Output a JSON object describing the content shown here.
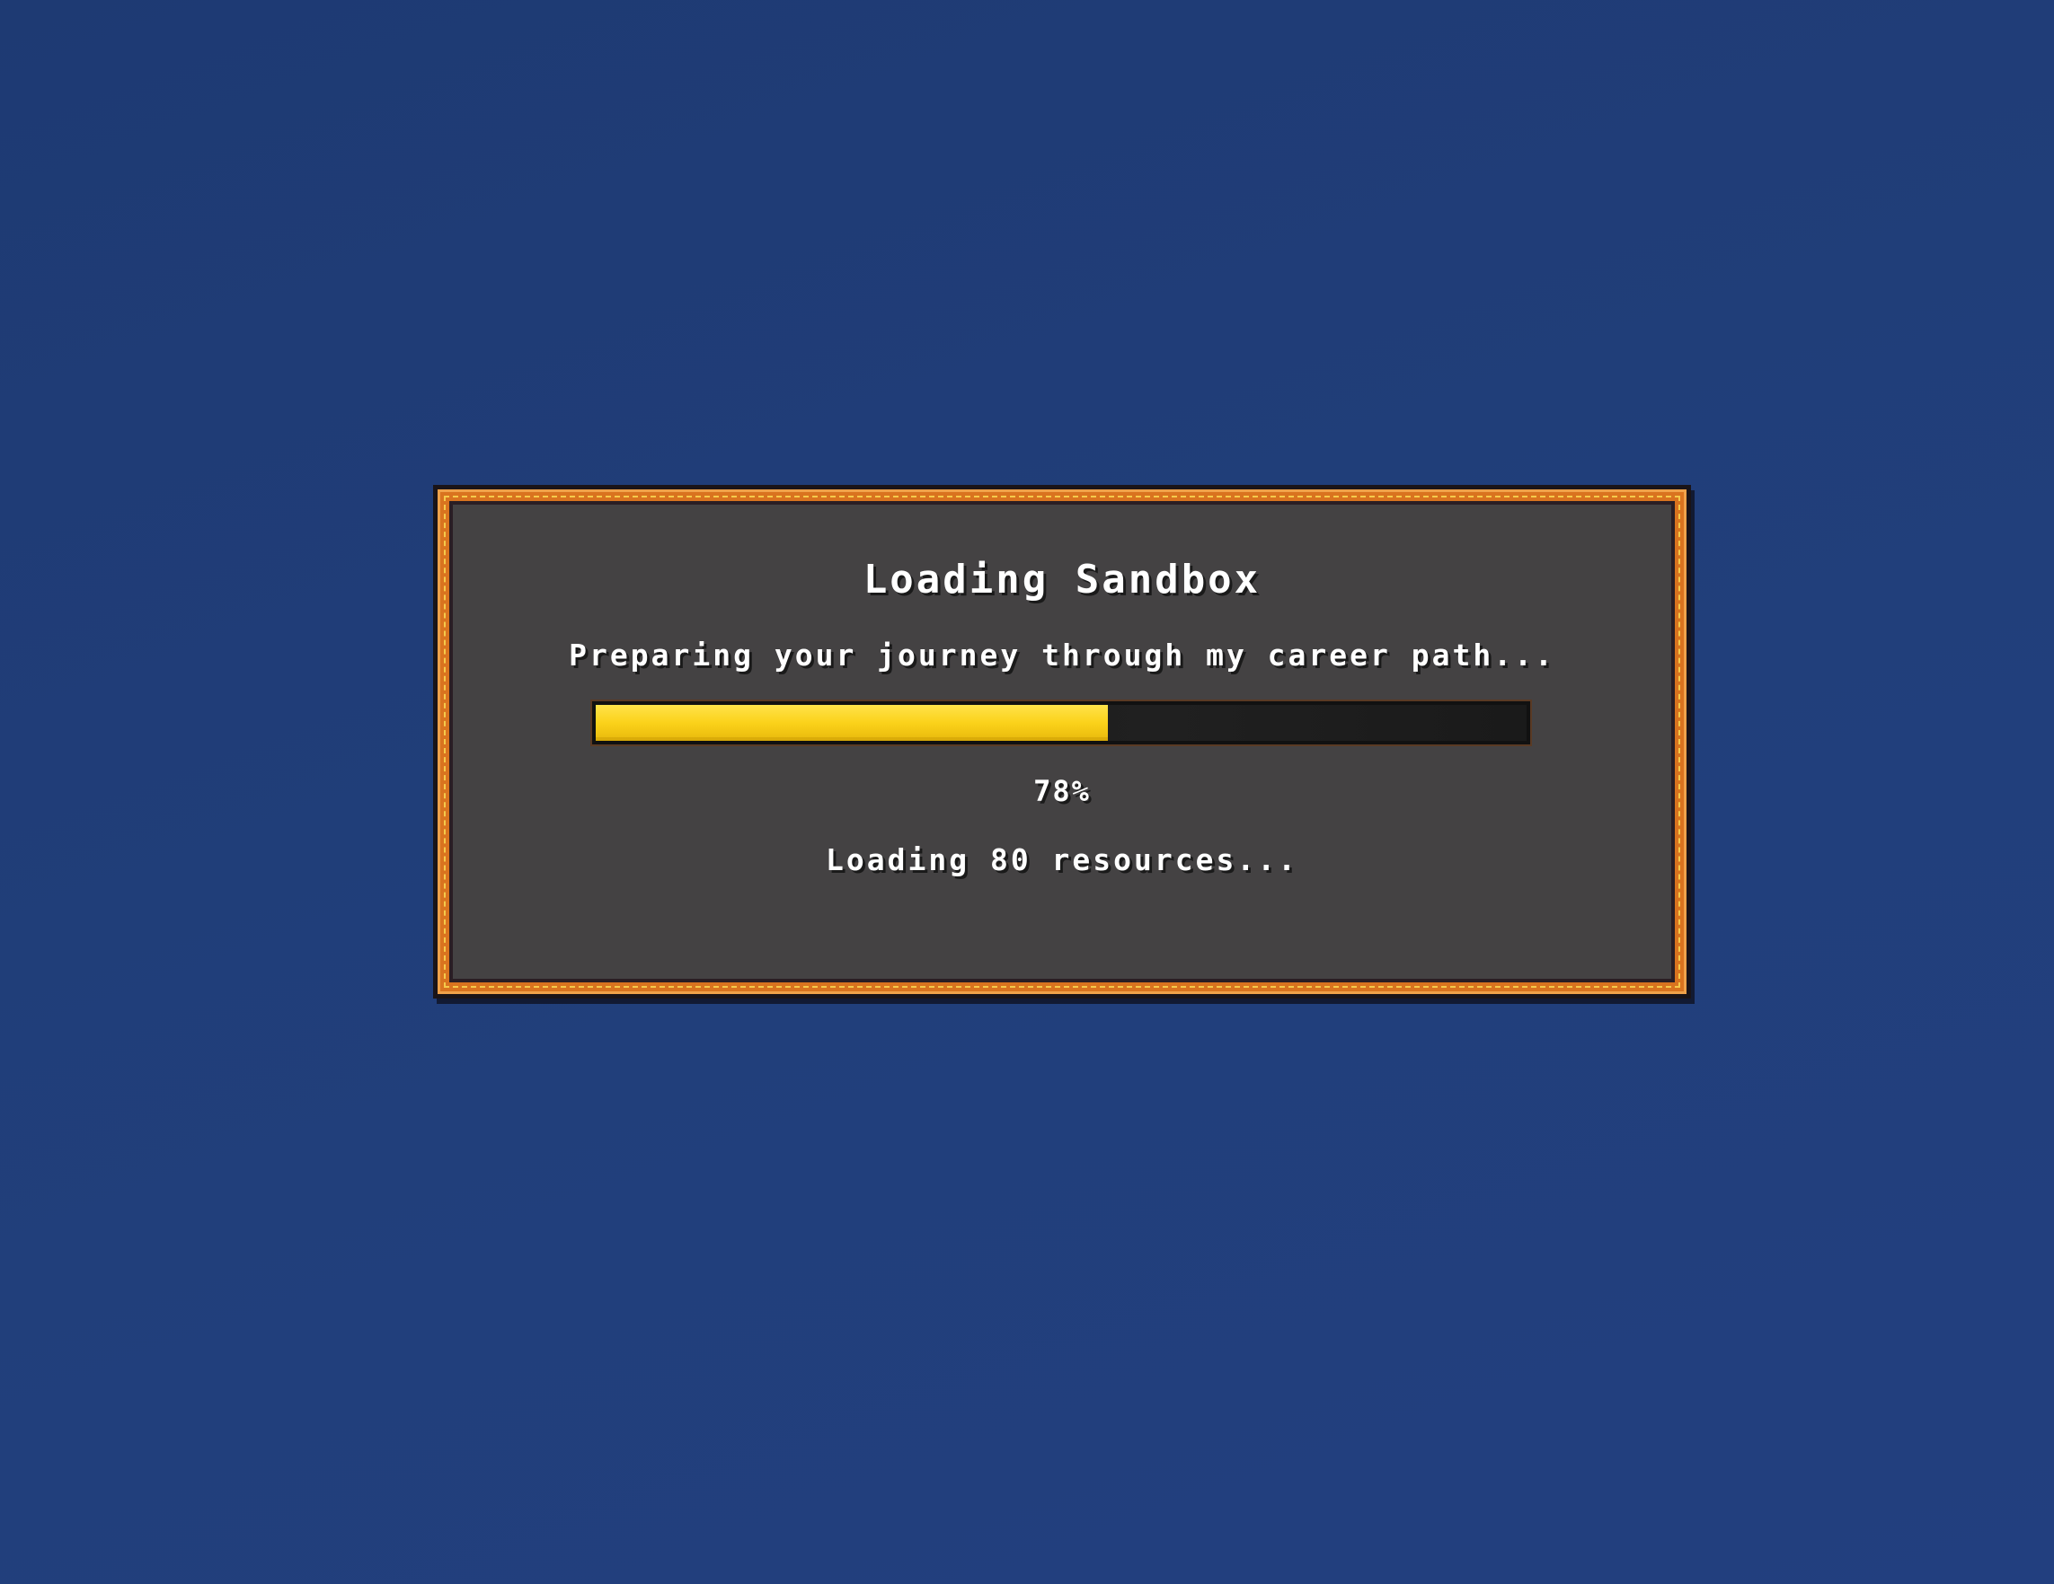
{
  "loading": {
    "title": "Loading Sandbox",
    "subtitle": "Preparing your journey through my career path...",
    "progress_value": 0.55,
    "percent_label": "78%",
    "status": "Loading 80 resources..."
  },
  "colors": {
    "background": "#213f7b",
    "frame": "#d9731f",
    "panel": "#444243",
    "progress_fill": "#fbd21a"
  }
}
